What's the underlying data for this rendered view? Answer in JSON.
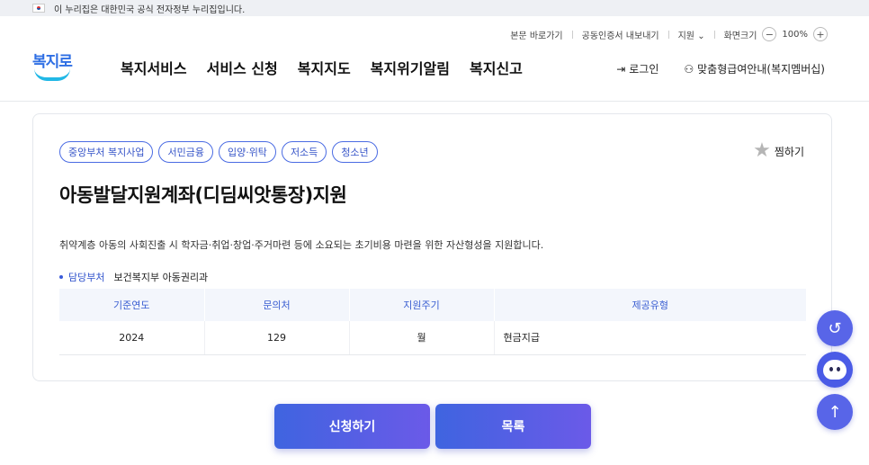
{
  "gov_banner": {
    "text": "이 누리집은 대한민국 공식 전자정부 누리집입니다."
  },
  "util": {
    "skip": "본문 바로가기",
    "cert": "공동인증서 내보내기",
    "support": "지원",
    "screen_size": "화면크기",
    "zoom_minus": "−",
    "zoom_level": "100%",
    "zoom_plus": "+"
  },
  "logo": {
    "text": "복지로"
  },
  "nav": [
    {
      "label": "복지서비스"
    },
    {
      "label": "서비스 신청"
    },
    {
      "label": "복지지도"
    },
    {
      "label": "복지위기알림"
    },
    {
      "label": "복지신고"
    }
  ],
  "user_menu": {
    "login": "로그인",
    "membership": "맞춤형급여안내(복지멤버십)"
  },
  "service": {
    "tags": [
      "중앙부처 복지사업",
      "서민금융",
      "입양·위탁",
      "저소득",
      "청소년"
    ],
    "favorite": "찜하기",
    "title": "아동발달지원계좌(디딤씨앗통장)지원",
    "description": "취약계층 아동의 사회진출 시 학자금·취업·창업·주거마련 등에 소요되는 초기비용 마련을 위한 자산형성을 지원합니다.",
    "dept_label": "담당부처",
    "dept_value": "보건복지부 아동권리과",
    "table": {
      "headers": [
        "기준연도",
        "문의처",
        "지원주기",
        "제공유형"
      ],
      "row": [
        "2024",
        "129",
        "월",
        "현금지급"
      ]
    }
  },
  "buttons": {
    "apply": "신청하기",
    "list": "목록"
  },
  "colors": {
    "accent": "#3f64e0",
    "accent_end": "#6b5ae8",
    "tag_border": "#4a6be3",
    "table_header_bg": "#f3f6fc"
  }
}
